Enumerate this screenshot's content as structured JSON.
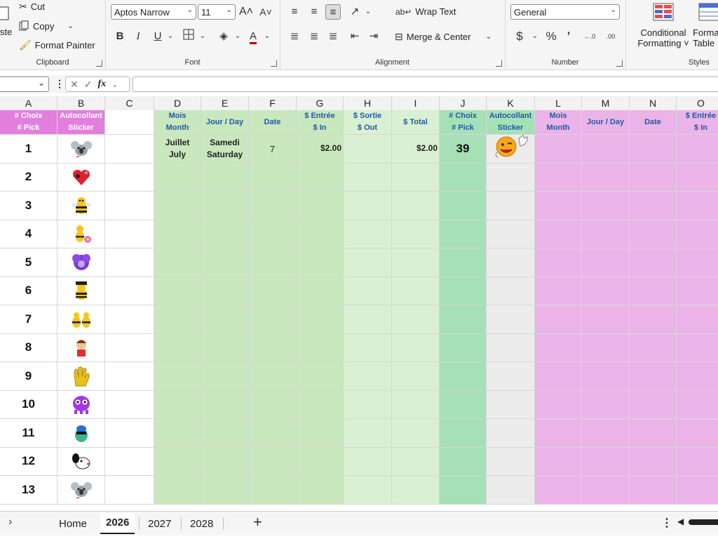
{
  "ribbon": {
    "clipboard": {
      "paste": "ste",
      "cut": "Cut",
      "copy": "Copy",
      "format_painter": "Format Painter",
      "label": "Clipboard"
    },
    "font": {
      "name": "Aptos Narrow",
      "size": "11",
      "label": "Font",
      "bold": "B",
      "italic": "I",
      "underline": "U",
      "grow": "A˄",
      "shrink": "A˅"
    },
    "alignment": {
      "wrap_text": "Wrap Text",
      "merge_center": "Merge & Center",
      "label": "Alignment"
    },
    "number": {
      "format": "General",
      "currency": "$",
      "percent": "%",
      "comma": "’",
      "inc_dec": "←.0",
      "dec_dec": ".00",
      "label": "Number"
    },
    "styles": {
      "conditional_l1": "Conditional",
      "conditional_l2": "Formatting ˅",
      "format_l1": "Format",
      "format_l2": "Table",
      "label": "Styles"
    }
  },
  "formula_bar": {
    "fx": "fx"
  },
  "columns": [
    "A",
    "B",
    "C",
    "D",
    "E",
    "F",
    "G",
    "H",
    "I",
    "J",
    "K",
    "L",
    "M",
    "N",
    "O"
  ],
  "headers": {
    "A": [
      "# Choix",
      "# Pick"
    ],
    "B": [
      "Autocollant",
      "Sticker"
    ],
    "D": [
      "Mois",
      "Month"
    ],
    "E": [
      "Jour / Day",
      ""
    ],
    "F": [
      "Date",
      ""
    ],
    "G": [
      "$ Entrée",
      "$ In"
    ],
    "H": [
      "$ Sortie",
      "$ Out"
    ],
    "I": [
      "$ Total",
      ""
    ],
    "J": [
      "# Choix",
      "# Pick"
    ],
    "K": [
      "Autocollant",
      "Sticker"
    ],
    "L": [
      "Mois",
      "Month"
    ],
    "M": [
      "Jour / Day",
      ""
    ],
    "N": [
      "Date",
      ""
    ],
    "O": [
      "$ Entrée",
      "$ In"
    ]
  },
  "row_numbers": [
    "1",
    "2",
    "3",
    "4",
    "5",
    "6",
    "7",
    "8",
    "9",
    "10",
    "11",
    "12",
    "13"
  ],
  "first_entry": {
    "month_l1": "Juillet",
    "month_l2": "July",
    "day_l1": "Samedi",
    "day_l2": "Saturday",
    "date": "7",
    "in": "$2.00",
    "total": "$2.00",
    "pick": "39"
  },
  "stickers": [
    "koala-sticker",
    "heart-dog-sticker",
    "bee-sticker",
    "bee-flower-sticker",
    "purple-flower-sticker",
    "bee-hat-sticker",
    "two-bees-sticker",
    "kid-sticker",
    "glove-sticker",
    "purple-monster-sticker",
    "green-bird-sticker",
    "dog-sticker",
    "koala-sticker"
  ],
  "sheet_tabs": [
    "Home",
    "2026",
    "2027",
    "2028"
  ],
  "active_tab": "2026",
  "colors": {
    "header_pink": "#e27fdc",
    "header_text_green": "#1f5aa8",
    "green_light": "#c9e8bd",
    "green_lighter": "#daf0d2",
    "green_mid": "#a6e0b6",
    "pink_light": "#ebb4e8",
    "gray_k": "#ececec"
  }
}
